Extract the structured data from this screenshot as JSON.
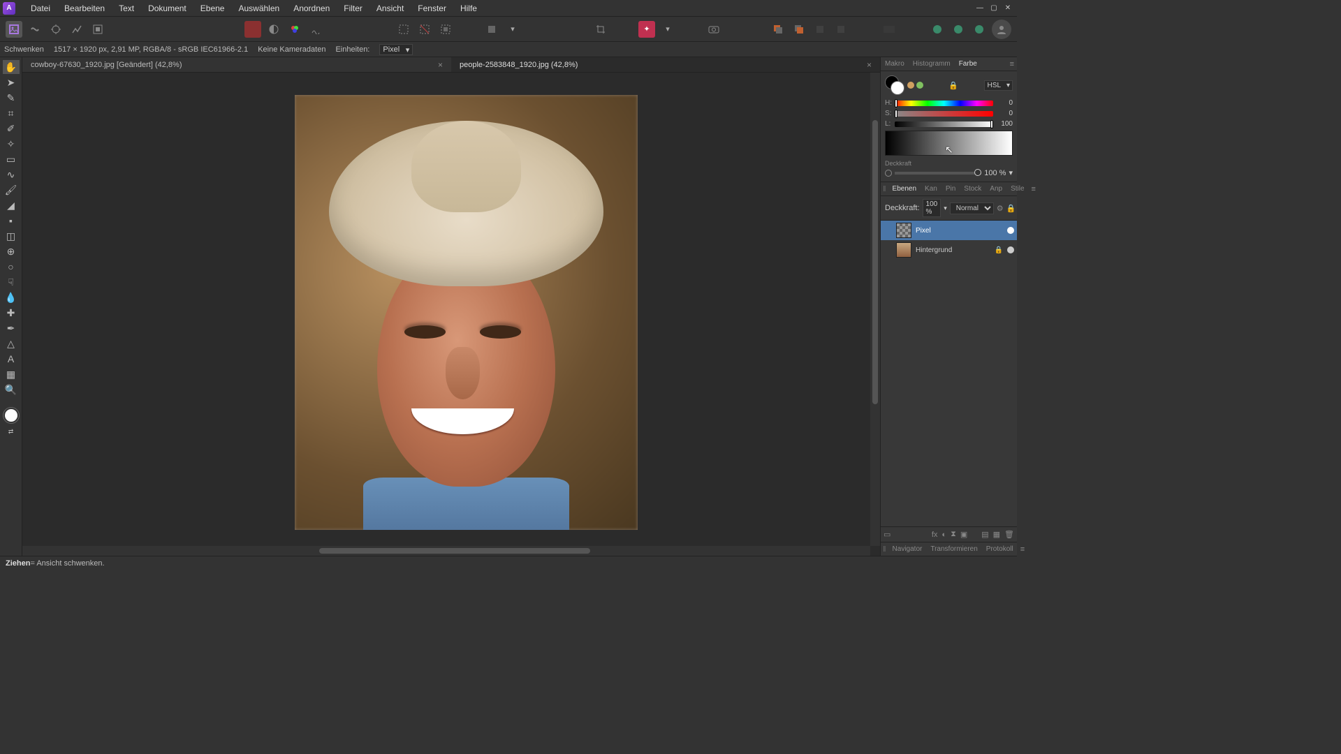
{
  "menu": {
    "items": [
      "Datei",
      "Bearbeiten",
      "Text",
      "Dokument",
      "Ebene",
      "Auswählen",
      "Anordnen",
      "Filter",
      "Ansicht",
      "Fenster",
      "Hilfe"
    ]
  },
  "context": {
    "tool": "Schwenken",
    "dims": "1517 × 1920 px, 2,91 MP, RGBA/8 - sRGB IEC61966-2.1",
    "camera": "Keine Kameradaten",
    "units_label": "Einheiten:",
    "units_value": "Pixel"
  },
  "tabs": [
    {
      "label": "cowboy-67630_1920.jpg [Geändert] (42,8%)",
      "active": false
    },
    {
      "label": "people-2583848_1920.jpg (42,8%)",
      "active": true
    }
  ],
  "color_panel": {
    "tabs": [
      "Makro",
      "Histogramm",
      "Farbe"
    ],
    "active_tab": 2,
    "mode": "HSL",
    "h": {
      "label": "H:",
      "value": "0",
      "pos": 0
    },
    "s": {
      "label": "S:",
      "value": "0",
      "pos": 0
    },
    "l": {
      "label": "L:",
      "value": "100",
      "pos": 100
    },
    "opacity_label": "Deckkraft",
    "opacity_value": "100 %"
  },
  "layers_panel": {
    "tabs": [
      "Ebenen",
      "Kan",
      "Pin",
      "Stock",
      "Anp",
      "Stile"
    ],
    "active_tab": 0,
    "opacity_label": "Deckkraft:",
    "opacity_value": "100 %",
    "blend": "Normal",
    "layers": [
      {
        "name": "Pixel",
        "selected": true,
        "transparent": true,
        "visible": true,
        "locked": false
      },
      {
        "name": "Hintergrund",
        "selected": false,
        "transparent": false,
        "visible": true,
        "locked": true
      }
    ]
  },
  "bottom_panel_tabs": [
    "Navigator",
    "Transformieren",
    "Protokoll"
  ],
  "status": {
    "action": "Ziehen",
    "desc": " = Ansicht schwenken."
  }
}
